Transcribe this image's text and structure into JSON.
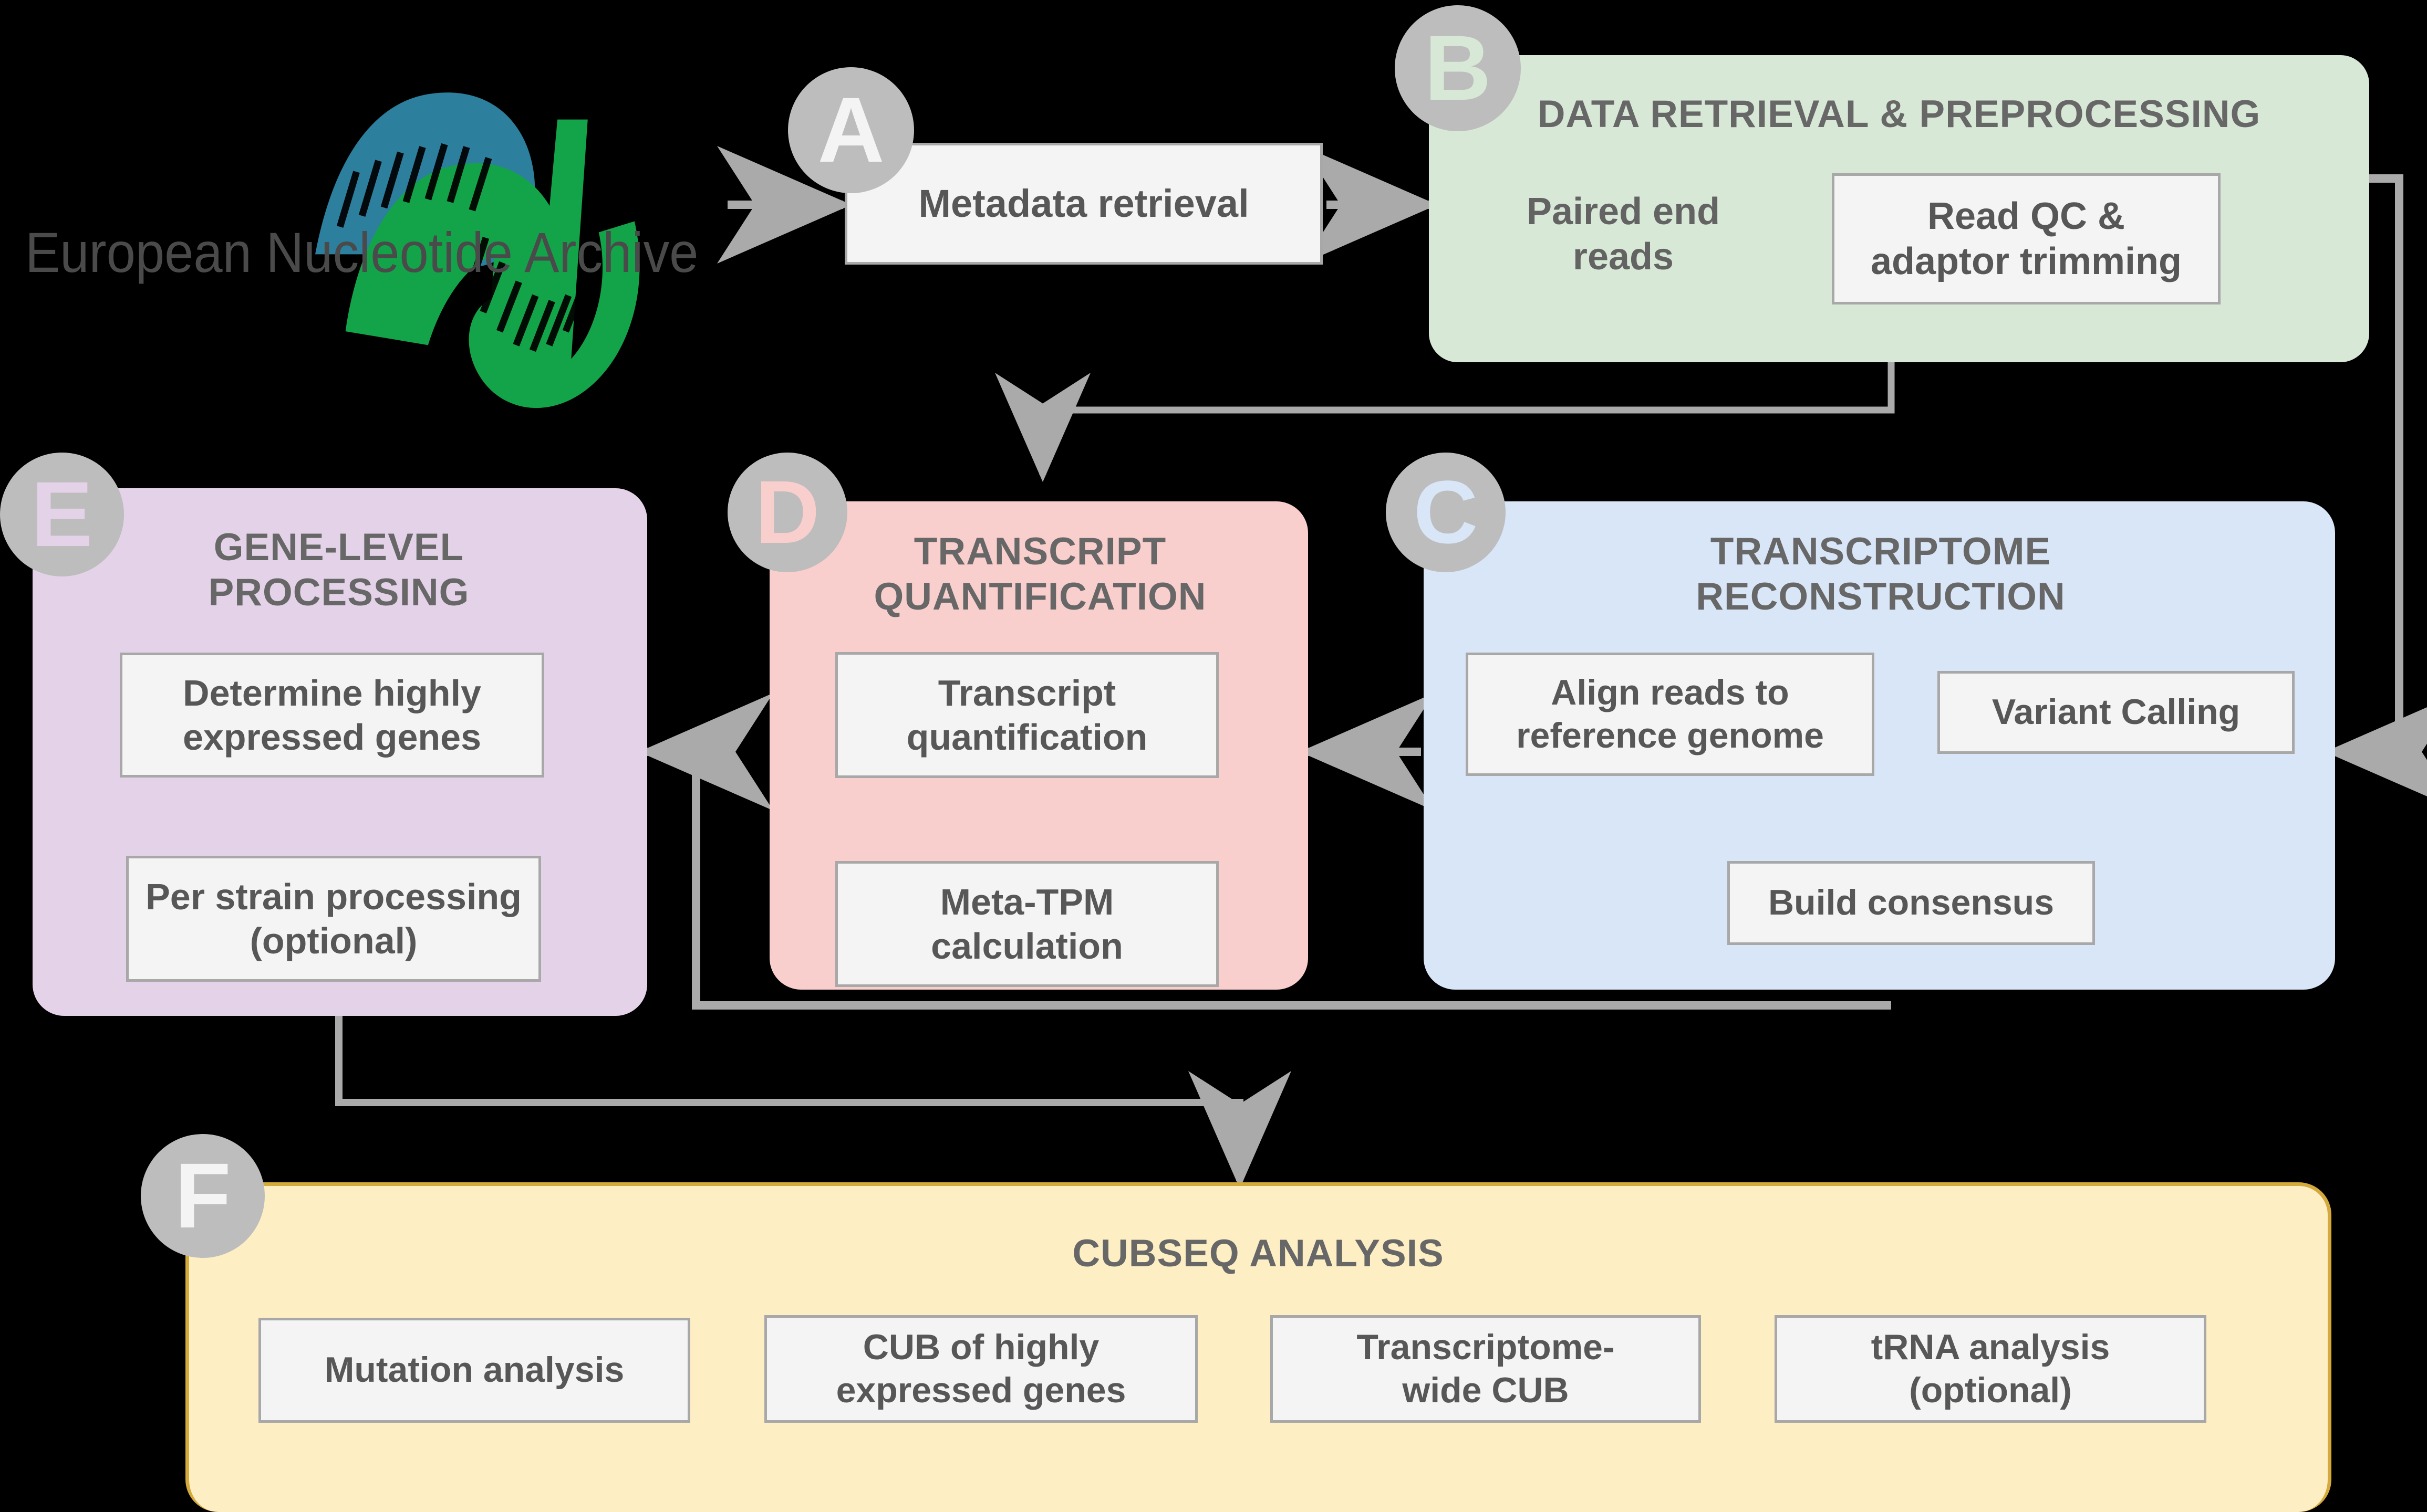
{
  "figure": {
    "type": "pipeline-flowchart",
    "background": "#000000",
    "source_logo": {
      "name": "European Nucleotide Archive",
      "label": "European Nucleotide Archive",
      "colors": {
        "helix_blue": "#2d7f9e",
        "helix_green": "#13a44a",
        "text": "#4a4a4a"
      }
    },
    "colors": {
      "badge_fill": "#bdbdbd",
      "node_fill": "#f4f4f4",
      "node_border": "#a8a8a8",
      "connector": "#aaaaaa",
      "title_text": "#676767",
      "node_text": "#575757",
      "panel_b": "#d8e8d6",
      "panel_c": "#d9e6f8",
      "panel_d": "#f9cfcd",
      "panel_e": "#e4d3e8",
      "panel_f": "#fdeec4",
      "panel_f_border": "#d4aa3c"
    },
    "standalone_nodes": [
      {
        "id": "metadata",
        "label": "Metadata retrieval"
      }
    ],
    "panels": [
      {
        "id": "A",
        "badge": "A",
        "badge_letter_color": "#f4f4f4",
        "title": "",
        "nodes": [
          {
            "label": "Metadata retrieval"
          }
        ]
      },
      {
        "id": "B",
        "badge": "B",
        "badge_letter_color": "#d8e8d6",
        "title": "DATA RETRIEVAL & PREPROCESSING",
        "fill": "#d8e8d6",
        "plain_labels": [
          {
            "label": "Paired end\nreads",
            "line1": "Paired end",
            "line2": "reads"
          }
        ],
        "nodes": [
          {
            "label": "Read QC &\nadaptor trimming",
            "line1": "Read QC &",
            "line2": "adaptor trimming"
          }
        ]
      },
      {
        "id": "C",
        "badge": "C",
        "badge_letter_color": "#d9e6f8",
        "title": "TRANSCRIPTOME\nRECONSTRUCTION",
        "title_line1": "TRANSCRIPTOME",
        "title_line2": "RECONSTRUCTION",
        "fill": "#d9e6f8",
        "nodes": [
          {
            "label": "Align reads to\nreference genome",
            "line1": "Align reads to",
            "line2": "reference genome"
          },
          {
            "label": "Variant Calling",
            "line1": "Variant Calling",
            "line2": ""
          },
          {
            "label": "Build consensus",
            "line1": "Build consensus",
            "line2": ""
          }
        ]
      },
      {
        "id": "D",
        "badge": "D",
        "badge_letter_color": "#f9cfcd",
        "title": "TRANSCRIPT\nQUANTIFICATION",
        "title_line1": "TRANSCRIPT",
        "title_line2": "QUANTIFICATION",
        "fill": "#f9cfcd",
        "nodes": [
          {
            "label": "Transcript\nquantification",
            "line1": "Transcript",
            "line2": "quantification"
          },
          {
            "label": "Meta-TPM\ncalculation",
            "line1": "Meta-TPM",
            "line2": "calculation"
          }
        ]
      },
      {
        "id": "E",
        "badge": "E",
        "badge_letter_color": "#e4d3e8",
        "title": "GENE-LEVEL\nPROCESSING",
        "title_line1": "GENE-LEVEL",
        "title_line2": "PROCESSING",
        "fill": "#e4d3e8",
        "nodes": [
          {
            "label": "Determine highly\nexpressed genes",
            "line1": "Determine highly",
            "line2": "expressed genes"
          },
          {
            "label": "Per strain processing\n(optional)",
            "line1": "Per strain processing",
            "line2": "(optional)"
          }
        ]
      },
      {
        "id": "F",
        "badge": "F",
        "badge_letter_color": "#f4f4f4",
        "title": "CUBSEQ ANALYSIS",
        "fill": "#fdeec4",
        "nodes": [
          {
            "label": "Mutation analysis",
            "line1": "Mutation analysis",
            "line2": ""
          },
          {
            "label": "CUB of highly\nexpressed genes",
            "line1": "CUB of highly",
            "line2": "expressed genes"
          },
          {
            "label": "Transcriptome-\nwide CUB",
            "line1": "Transcriptome-",
            "line2": "wide CUB"
          },
          {
            "label": "tRNA analysis\n(optional)",
            "line1": "tRNA analysis",
            "line2": "(optional)"
          }
        ]
      }
    ],
    "connections": [
      {
        "from": "ENA logo",
        "to": "Metadata retrieval"
      },
      {
        "from": "Metadata retrieval",
        "to": "DATA RETRIEVAL & PREPROCESSING"
      },
      {
        "from": "Paired end reads",
        "to": "Read QC & adaptor trimming"
      },
      {
        "from": "DATA RETRIEVAL & PREPROCESSING",
        "to": "TRANSCRIPT QUANTIFICATION"
      },
      {
        "from": "DATA RETRIEVAL & PREPROCESSING",
        "to": "TRANSCRIPTOME RECONSTRUCTION"
      },
      {
        "from": "Align reads to reference genome",
        "to": "Variant Calling"
      },
      {
        "from": "Variant Calling",
        "to": "Build consensus"
      },
      {
        "from": "TRANSCRIPTOME RECONSTRUCTION",
        "to": "TRANSCRIPT QUANTIFICATION"
      },
      {
        "from": "Transcript quantification",
        "to": "Meta-TPM calculation"
      },
      {
        "from": "TRANSCRIPT QUANTIFICATION",
        "to": "GENE-LEVEL PROCESSING"
      },
      {
        "from": "Determine highly expressed genes",
        "to": "Per strain processing (optional)"
      },
      {
        "from": "TRANSCRIPTOME RECONSTRUCTION",
        "to": "GENE-LEVEL PROCESSING"
      },
      {
        "from": "GENE-LEVEL PROCESSING",
        "to": "CUBSEQ ANALYSIS"
      }
    ]
  }
}
